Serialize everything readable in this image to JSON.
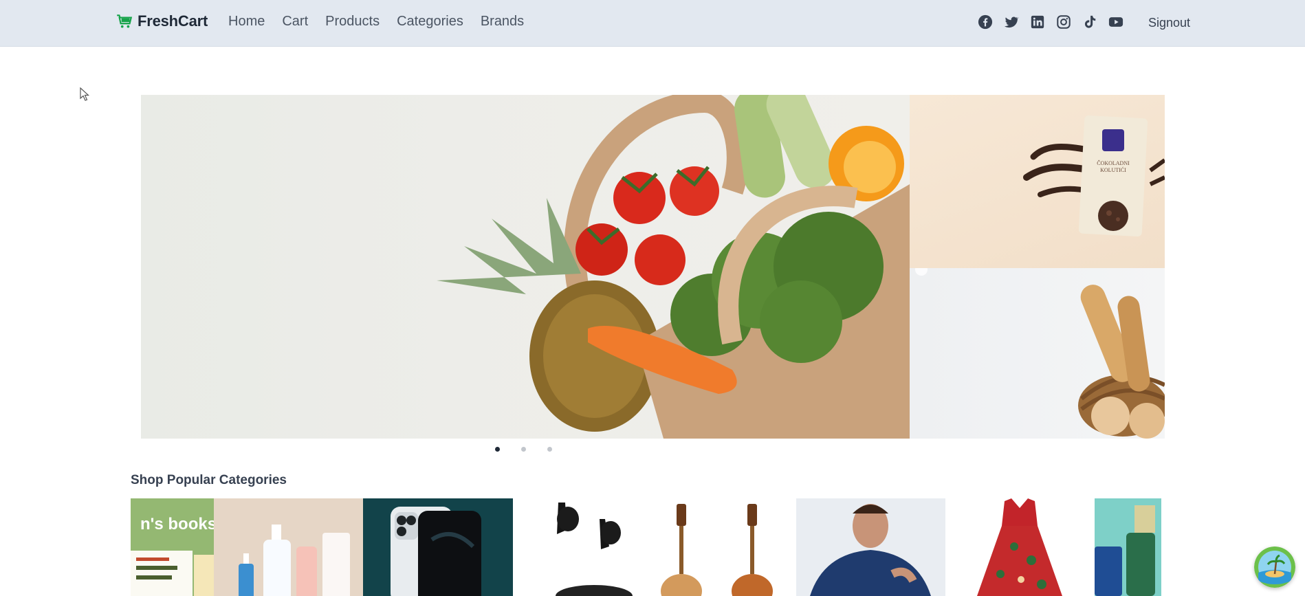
{
  "navbar": {
    "brand": "FreshCart",
    "brand_icon": "shopping-cart-icon",
    "links": [
      "Home",
      "Cart",
      "Products",
      "Categories",
      "Brands"
    ],
    "social_icons": [
      "facebook-icon",
      "twitter-icon",
      "linkedin-icon",
      "instagram-icon",
      "tiktok-icon",
      "youtube-icon"
    ],
    "signout": "Signout"
  },
  "slider": {
    "main_image": "grocery-bag-image",
    "side_images": [
      "cookies-package-image",
      "bread-basket-image"
    ],
    "packaging_text": "ČOKOLADNI KOLUTIĆI",
    "dots": 3,
    "active_dot": 0
  },
  "categories": {
    "title": "Shop Popular Categories",
    "books_label": "n's books",
    "tiles": [
      "books-tile",
      "beauty-tile",
      "mobiles-tile",
      "electronics-tile",
      "music-tile",
      "mens-fashion-tile",
      "womens-fashion-tile",
      "supermarket-tile"
    ]
  },
  "colors": {
    "navbar_bg": "#e2e8f0",
    "brand_green": "#16a34a",
    "accent": "#1f2937"
  }
}
